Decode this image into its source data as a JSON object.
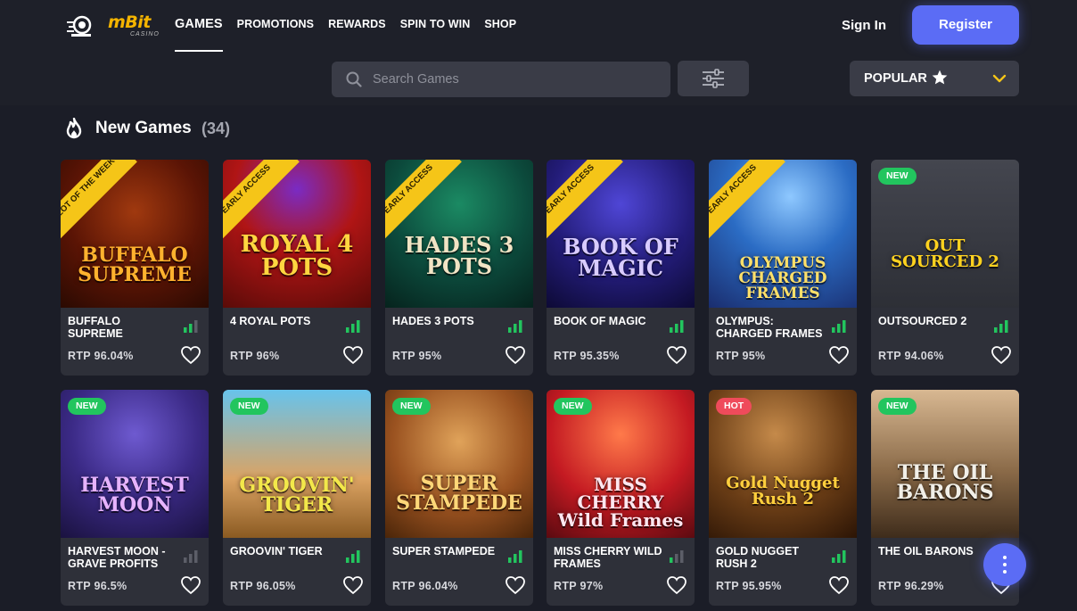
{
  "header": {
    "brand": "mBit",
    "brand_sub": "CASINO",
    "nav": [
      "GAMES",
      "PROMOTIONS",
      "REWARDS",
      "SPIN TO WIN",
      "SHOP"
    ],
    "active_nav": "GAMES",
    "signin": "Sign In",
    "register": "Register"
  },
  "search": {
    "placeholder": "Search Games"
  },
  "sort": {
    "label": "POPULAR"
  },
  "section": {
    "title": "New Games",
    "count": "(34)"
  },
  "colors": {
    "accent": "#5b6cf5",
    "ribbon": "#f5c518",
    "badge_new": "#22c55e",
    "badge_hot": "#ef4b5b",
    "bar_active": "#22c55e",
    "bar_inactive": "#5c5e68"
  },
  "games": [
    {
      "name": "BUFFALO SUPREME",
      "rtp": "RTP 96.04%",
      "ribbon": "SLOT OF THE WEEK",
      "badge": "",
      "art": "BUFFALO SUPREME",
      "bars": 2
    },
    {
      "name": "4 ROYAL POTS",
      "rtp": "RTP 96%",
      "ribbon": "EARLY ACCESS",
      "badge": "",
      "art": "ROYAL 4 POTS",
      "bars": 3
    },
    {
      "name": "HADES 3 POTS",
      "rtp": "RTP 95%",
      "ribbon": "EARLY ACCESS",
      "badge": "",
      "art": "HADES 3 POTS",
      "bars": 3
    },
    {
      "name": "BOOK OF MAGIC",
      "rtp": "RTP 95.35%",
      "ribbon": "EARLY ACCESS",
      "badge": "",
      "art": "BOOK OF MAGIC",
      "bars": 3
    },
    {
      "name": "OLYMPUS: CHARGED FRAMES",
      "rtp": "RTP 95%",
      "ribbon": "EARLY ACCESS",
      "badge": "",
      "art": "OLYMPUS CHARGED FRAMES",
      "bars": 3
    },
    {
      "name": "OUTSOURCED 2",
      "rtp": "RTP 94.06%",
      "ribbon": "",
      "badge": "NEW",
      "art": "OUT SOURCED 2",
      "bars": 3
    },
    {
      "name": "HARVEST MOON - GRAVE PROFITS",
      "rtp": "RTP 96.5%",
      "ribbon": "",
      "badge": "NEW",
      "art": "HARVEST MOON",
      "bars": 0
    },
    {
      "name": "GROOVIN' TIGER",
      "rtp": "RTP 96.05%",
      "ribbon": "",
      "badge": "NEW",
      "art": "GROOVIN' TIGER",
      "bars": 3
    },
    {
      "name": "SUPER STAMPEDE",
      "rtp": "RTP 96.04%",
      "ribbon": "",
      "badge": "NEW",
      "art": "SUPER STAMPEDE",
      "bars": 3
    },
    {
      "name": "MISS CHERRY WILD FRAMES",
      "rtp": "RTP 97%",
      "ribbon": "",
      "badge": "NEW",
      "art": "MISS CHERRY Wild Frames",
      "bars": 1
    },
    {
      "name": "GOLD NUGGET RUSH 2",
      "rtp": "RTP 95.95%",
      "ribbon": "",
      "badge": "HOT",
      "art": "Gold Nugget Rush 2",
      "bars": 3
    },
    {
      "name": "THE OIL BARONS",
      "rtp": "RTP 96.29%",
      "ribbon": "",
      "badge": "NEW",
      "art": "THE OIL BARONS",
      "bars": 0
    }
  ]
}
